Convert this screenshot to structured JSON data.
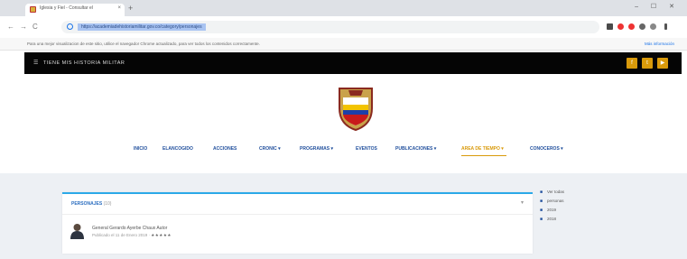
{
  "browser": {
    "tab_title": "Iglesia y Fiel - Consultar el",
    "tab_close": "×",
    "new_tab": "+",
    "window_controls": "– ☐ ✕",
    "nav_back": "←",
    "nav_forward": "→",
    "nav_reload": "C",
    "url": "https://academiadehistoriamilitar.gov.co/category/personajes",
    "info_message": "Para una mejor visualizacion de este sitio, utilice el navegador Chrome actualizado, para ver todos los contenidos correctamente.",
    "info_link": "Más información"
  },
  "site": {
    "menu_icon": "☰",
    "brand": "TIENE MIS HISTORIA MILITAR",
    "social": [
      "f",
      "t",
      "▶"
    ],
    "nav": [
      {
        "label": "INICIO"
      },
      {
        "label": "ELANCOGIDO"
      },
      {
        "label": "ACCIONES"
      },
      {
        "label": "CRONIC ▾"
      },
      {
        "label": "PROGRAMAS ▾"
      },
      {
        "label": "EVENTOS"
      },
      {
        "label": "PUBLICACIONES ▾"
      },
      {
        "label": "AREA DE TIEMPO ▾"
      },
      {
        "label": "CONOCEROS ▾"
      }
    ],
    "active_nav_index": 7
  },
  "card": {
    "title": "PERSONAJES",
    "subtitle": "(10)",
    "chevron": "▾",
    "post_name": "General Gerardo Ayerbe Chaux Autor",
    "post_meta": "Publicado el 11 de Enero 2019 ·",
    "post_stars": "★★★★★"
  },
  "sidebar": {
    "items": [
      {
        "bullet": "■",
        "label": "Ver todas"
      },
      {
        "bullet": "■",
        "label": "personas"
      },
      {
        "bullet": "■",
        "label": "2019"
      },
      {
        "bullet": "■",
        "label": "2018"
      }
    ]
  },
  "colors": {
    "accent": "#d99a0b",
    "nav_blue": "#1f4e9c",
    "card_border": "#2ba9e8",
    "topbar_bg": "#050505"
  }
}
